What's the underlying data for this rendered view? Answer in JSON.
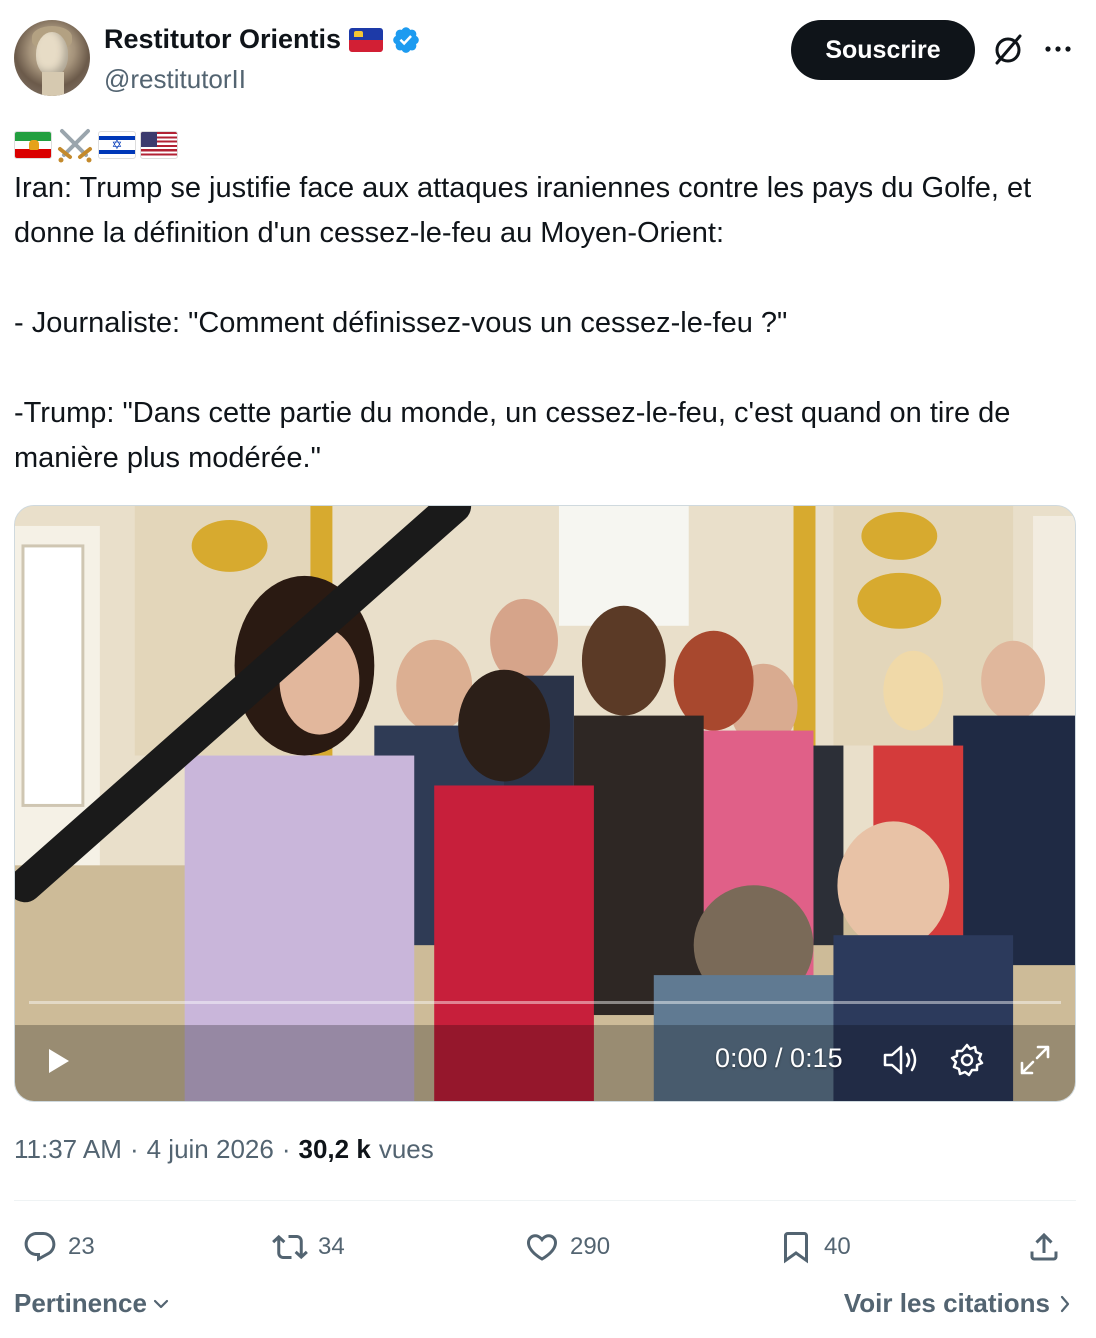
{
  "author": {
    "name": "Restitutor Orientis",
    "handle": "@restitutorII",
    "avatar_icon": "roman-bust-avatar",
    "flag_icon": "liechtenstein-flag-icon",
    "verified_icon": "verified-badge-icon"
  },
  "header_actions": {
    "subscribe_label": "Souscrire",
    "grok_icon": "grok-icon",
    "more_icon": "more-options-icon"
  },
  "tweet": {
    "emoji_prefix": [
      "iran-flag",
      "crossed-swords",
      "israel-flag",
      "usa-flag"
    ],
    "paragraphs": [
      "Iran: Trump se justifie face aux attaques iraniennes contre les pays du Golfe, et donne la définition d'un cessez-le-feu au Moyen-Orient:",
      "- Journaliste: \"Comment définissez-vous un cessez-le-feu ?\"",
      "-Trump: \"Dans cette partie du monde, un cessez-le-feu, c'est quand on tire de manière plus modérée.\""
    ]
  },
  "video": {
    "time_display": "0:00 / 0:15",
    "progress": 0,
    "controls": [
      "play-icon",
      "volume-icon",
      "settings-icon",
      "fullscreen-icon"
    ]
  },
  "meta": {
    "time": "11:37 AM",
    "separator": "·",
    "date": "4 juin 2026",
    "views_count": "30,2 k",
    "views_label": "vues"
  },
  "actions": {
    "replies": "23",
    "reposts": "34",
    "likes": "290",
    "bookmarks": "40",
    "share_icon": "share-icon"
  },
  "footer": {
    "sort_label": "Pertinence",
    "quotes_label": "Voir les citations"
  },
  "colors": {
    "text": "#0f1419",
    "secondary": "#536471",
    "verified": "#1d9bf0",
    "button_bg": "#0f1419"
  }
}
